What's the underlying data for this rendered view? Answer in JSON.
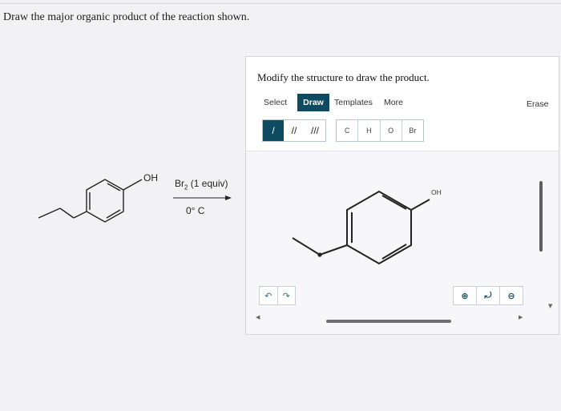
{
  "question": "Draw the major organic product of the reaction shown.",
  "reaction": {
    "substituent": "OH",
    "reagent": "Br2 (1 equiv)",
    "conditions": "0° C"
  },
  "editor": {
    "title": "Modify the structure to draw the product.",
    "tabs": {
      "select": "Select",
      "draw": "Draw",
      "templates": "Templates",
      "more": "More",
      "erase": "Erase"
    },
    "bond_tools": [
      "/",
      "//",
      "///"
    ],
    "atom_tools": [
      "C",
      "H",
      "O",
      "Br"
    ],
    "canvas_label": "OH",
    "icons": {
      "undo": "undo-icon",
      "redo": "redo-icon",
      "zoom_in": "zoom-in-icon",
      "zoom_reset": "zoom-reset-icon",
      "zoom_out": "zoom-out-icon"
    }
  }
}
